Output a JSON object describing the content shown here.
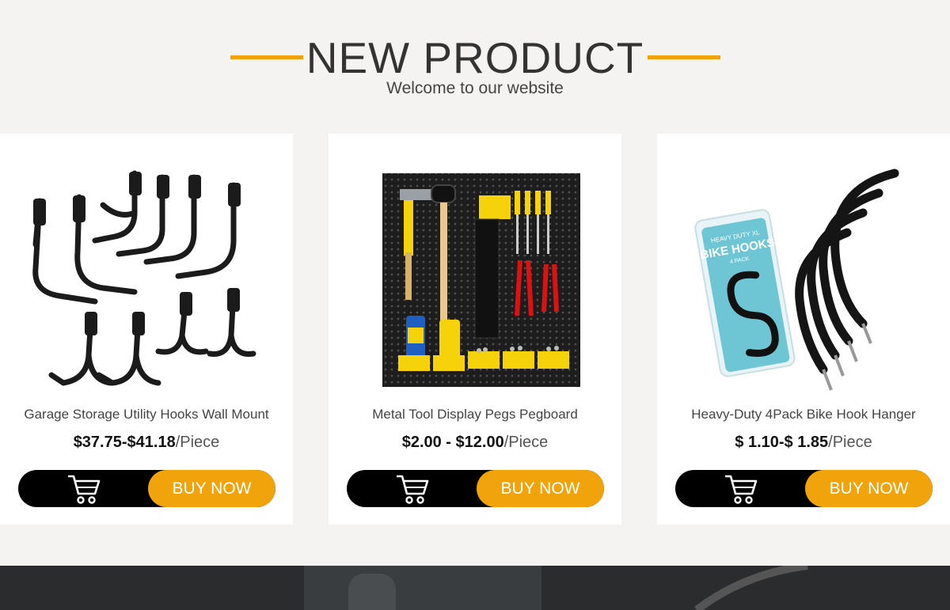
{
  "section": {
    "title": "NEW PRODUCT",
    "subtitle": "Welcome to our website",
    "accent_color": "#f0a30a"
  },
  "products": [
    {
      "name": "Garage Storage Utility Hooks Wall Mount",
      "price": "$37.75-$41.18",
      "unit": "/Piece",
      "image_icon": "wall-hooks-image",
      "cart_icon": "cart-icon",
      "buy_label": "BUY NOW"
    },
    {
      "name": "Metal Tool Display Pegs Pegboard",
      "price": "$2.00 - $12.00",
      "unit": "/Piece",
      "image_icon": "pegboard-image",
      "cart_icon": "cart-icon",
      "buy_label": "BUY NOW"
    },
    {
      "name": "Heavy-Duty 4Pack Bike Hook Hanger",
      "price": "$ 1.10-$ 1.85",
      "unit": "/Piece",
      "image_icon": "bike-hooks-image",
      "cart_icon": "cart-icon",
      "buy_label": "BUY NOW",
      "package_text": {
        "line1": "HEAVY DUTY XL",
        "line2": "BIKE HOOKS",
        "line3": "4 PACK"
      }
    }
  ]
}
